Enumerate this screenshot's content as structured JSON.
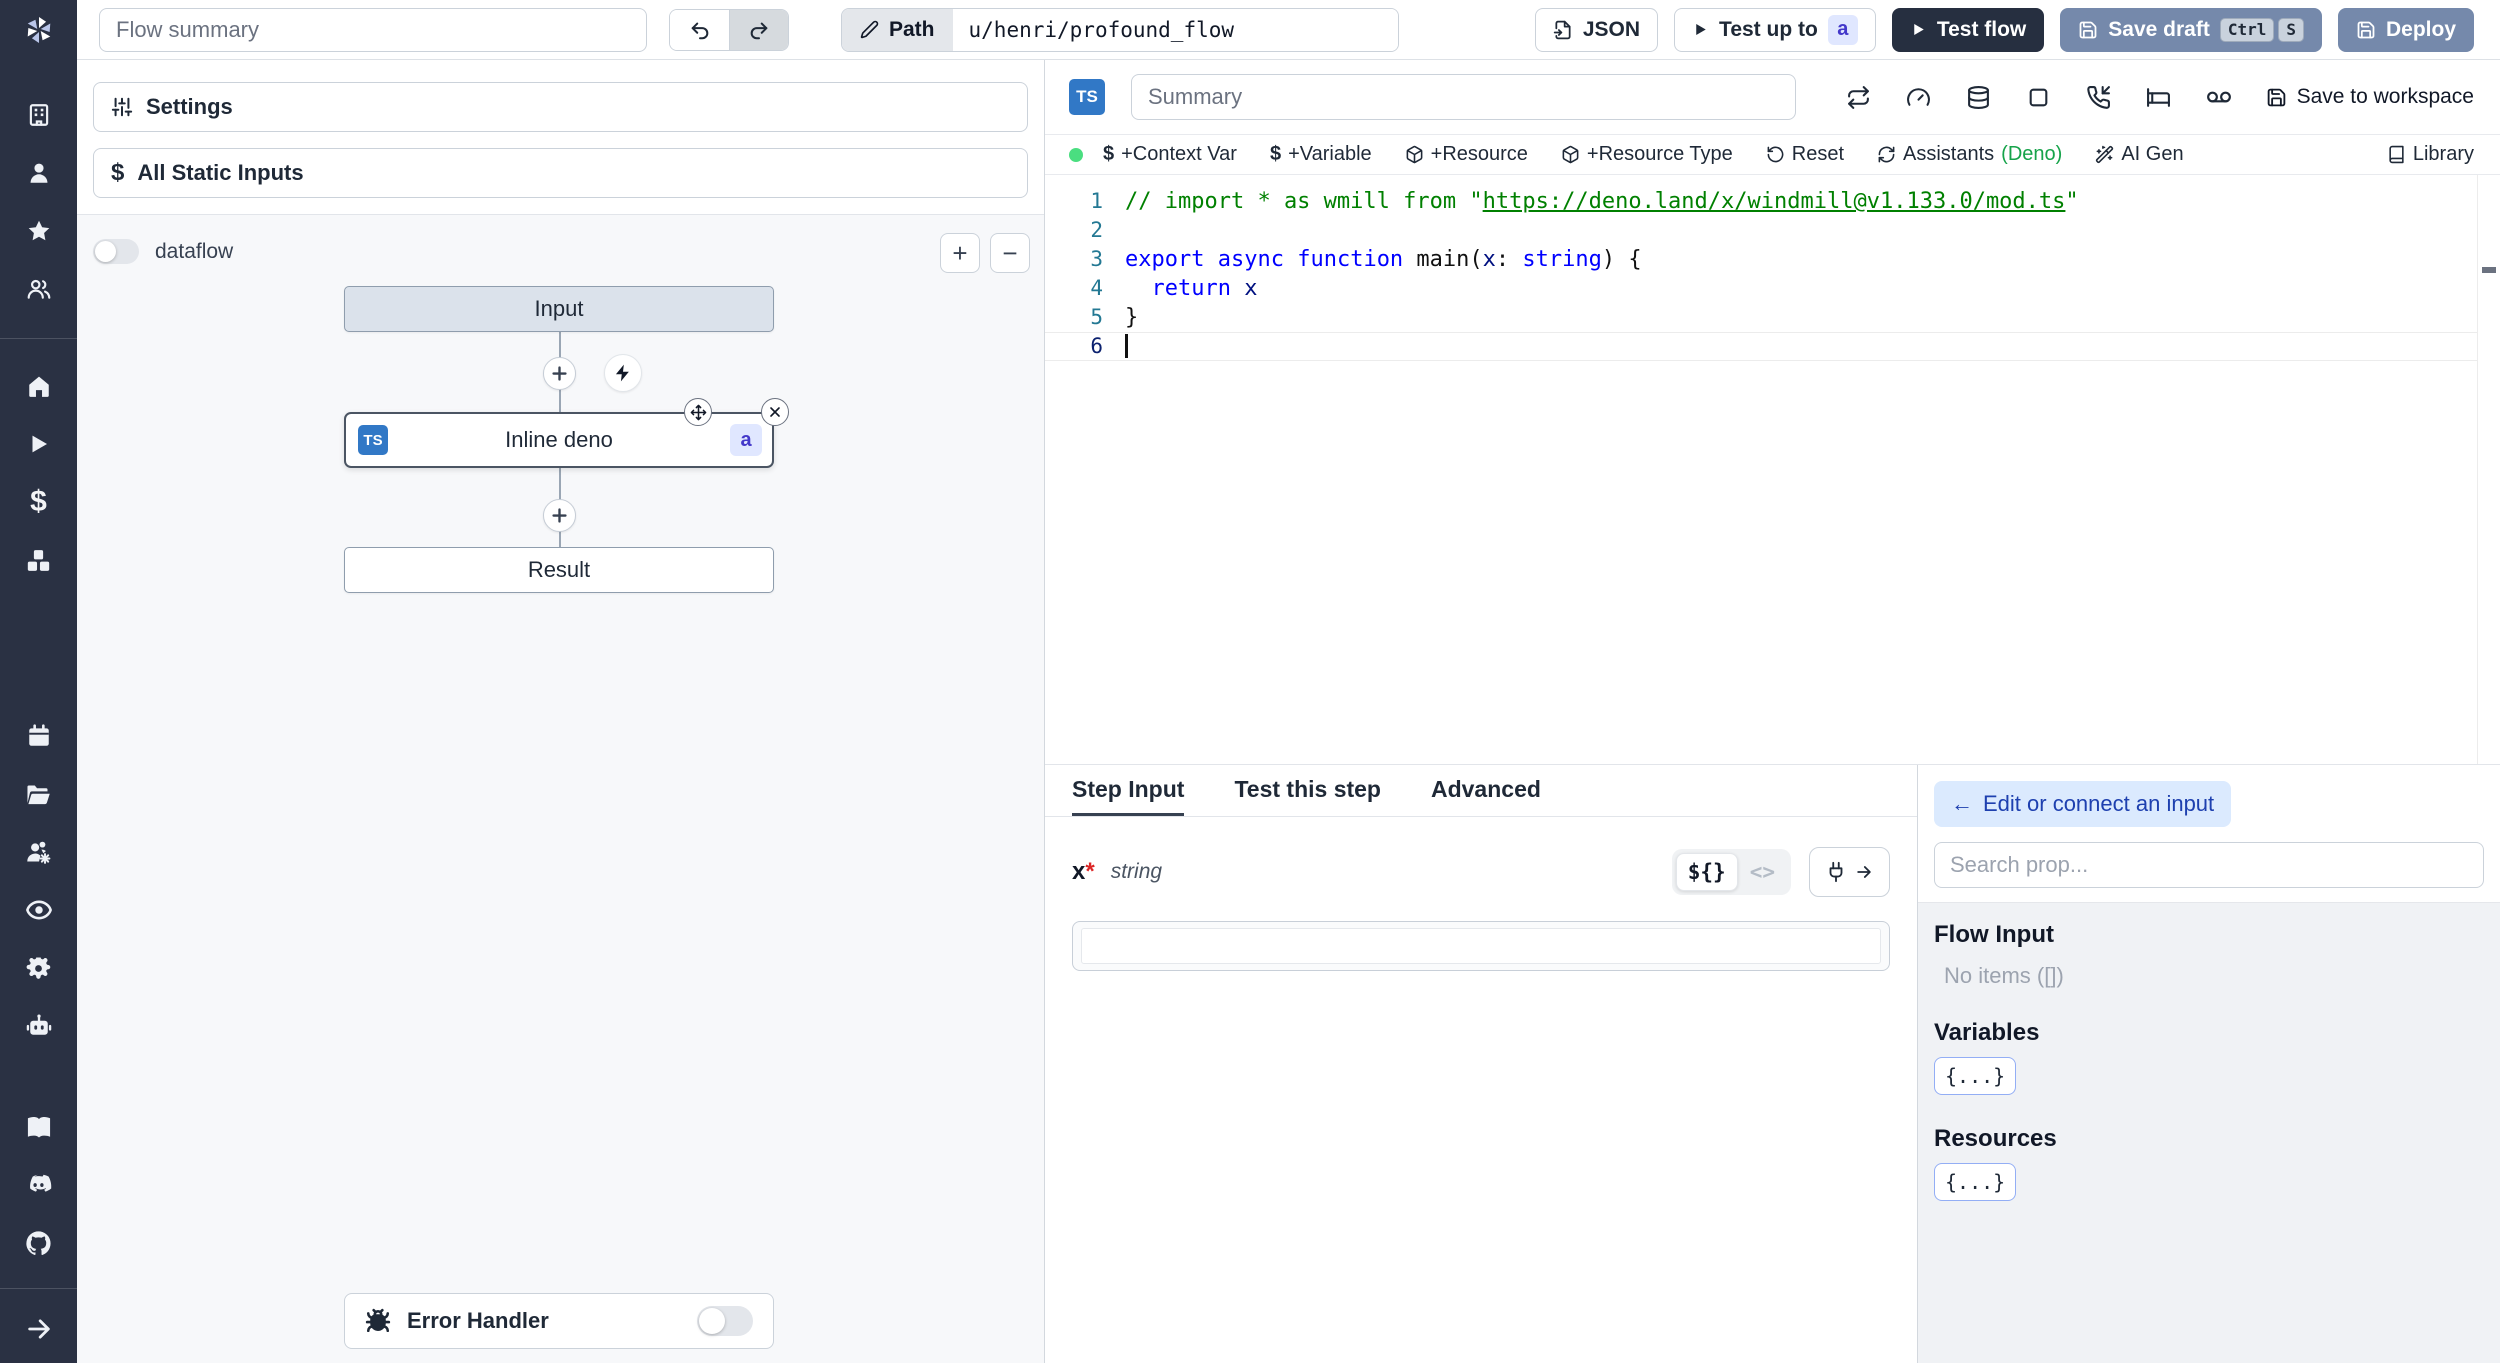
{
  "topbar": {
    "flow_summary_placeholder": "Flow summary",
    "path_label": "Path",
    "path_value": "u/henri/profound_flow",
    "json_label": "JSON",
    "test_up_to_label": "Test up to",
    "test_up_to_badge": "a",
    "test_flow_label": "Test flow",
    "save_draft_label": "Save draft",
    "kbd_ctrl": "Ctrl",
    "kbd_s": "S",
    "deploy_label": "Deploy"
  },
  "sidebar": {
    "icons_top": [
      "building",
      "user",
      "star",
      "users"
    ],
    "icons_middle": [
      "home",
      "play",
      "dollar",
      "boxes",
      "calendar",
      "folder-open",
      "users-cog",
      "eye",
      "settings-gear",
      "robot"
    ],
    "icons_bottom": [
      "book-open",
      "discord",
      "github"
    ],
    "expand_icon": "arrow-right",
    "dollar_glyph": "$"
  },
  "flow_panel": {
    "settings_label": "Settings",
    "all_static_inputs_label": "All Static Inputs",
    "dataflow_label": "dataflow",
    "zoom_in_label": "+",
    "zoom_out_label": "−",
    "graph": {
      "input_node": "Input",
      "step_node": "Inline deno",
      "step_lang_badge": "TS",
      "step_suffix_badge": "a",
      "result_node": "Result"
    },
    "error_handler_label": "Error Handler"
  },
  "editor": {
    "lang_badge": "TS",
    "summary_placeholder": "Summary",
    "header_icons": [
      "repeat",
      "gauge",
      "database",
      "square",
      "phone-incoming",
      "bed",
      "voicemail"
    ],
    "save_to_workspace_label": "Save to workspace",
    "toolbar": {
      "context_var": "+Context Var",
      "variable": "+Variable",
      "resource": "+Resource",
      "resource_type": "+Resource Type",
      "reset": "Reset",
      "assistants": "Assistants",
      "assistants_lang": "(Deno)",
      "ai_gen": "AI Gen",
      "library": "Library",
      "dollar_glyph": "$"
    },
    "code": {
      "active_line": 6,
      "lines": [
        {
          "num": "1",
          "tokens": [
            [
              "comment",
              "// import * as wmill from \""
            ],
            [
              "comment-link",
              "https://deno.land/x/windmill@v1.133.0/mod.ts"
            ],
            [
              "comment",
              "\""
            ]
          ]
        },
        {
          "num": "2",
          "tokens": []
        },
        {
          "num": "3",
          "tokens": [
            [
              "kw",
              "export"
            ],
            [
              "plain",
              " "
            ],
            [
              "kw",
              "async"
            ],
            [
              "plain",
              " "
            ],
            [
              "kw",
              "function"
            ],
            [
              "plain",
              " main("
            ],
            [
              "var",
              "x"
            ],
            [
              "plain",
              ": "
            ],
            [
              "type",
              "string"
            ],
            [
              "plain",
              ") {"
            ]
          ]
        },
        {
          "num": "4",
          "tokens": [
            [
              "plain",
              "  "
            ],
            [
              "kw",
              "return"
            ],
            [
              "plain",
              " "
            ],
            [
              "var",
              "x"
            ]
          ]
        },
        {
          "num": "5",
          "tokens": [
            [
              "plain",
              "}"
            ]
          ]
        },
        {
          "num": "6",
          "tokens": [],
          "active": true,
          "cursor": true
        }
      ]
    }
  },
  "step_panel": {
    "tabs": [
      "Step Input",
      "Test this step",
      "Advanced"
    ],
    "active_tab": "Step Input",
    "field": {
      "name": "x",
      "required_mark": "*",
      "type": "string"
    },
    "expr_toggle": "${}",
    "code_toggle": "<>"
  },
  "connect_panel": {
    "back_arrow": "←",
    "back_label": "Edit or connect an input",
    "search_placeholder": "Search prop...",
    "flow_input_title": "Flow Input",
    "flow_input_empty": "No items ([])",
    "variables_title": "Variables",
    "variables_chip": "{...}",
    "resources_title": "Resources",
    "resources_chip": "{...}"
  },
  "colors": {
    "sidebar_bg": "#2a3143",
    "ts_blue": "#3178c6",
    "badge_indigo_bg": "#e0e7ff",
    "badge_indigo_text": "#4338ca",
    "primary_slate_button": "#7589ab",
    "dark_button": "#262f40",
    "green_dot": "#4ade80",
    "deno_green": "#16a34a",
    "comment_green": "#008000",
    "keyword_blue": "#0000ff",
    "back_button_bg": "#dbeafe",
    "back_button_text": "#1e40af"
  }
}
